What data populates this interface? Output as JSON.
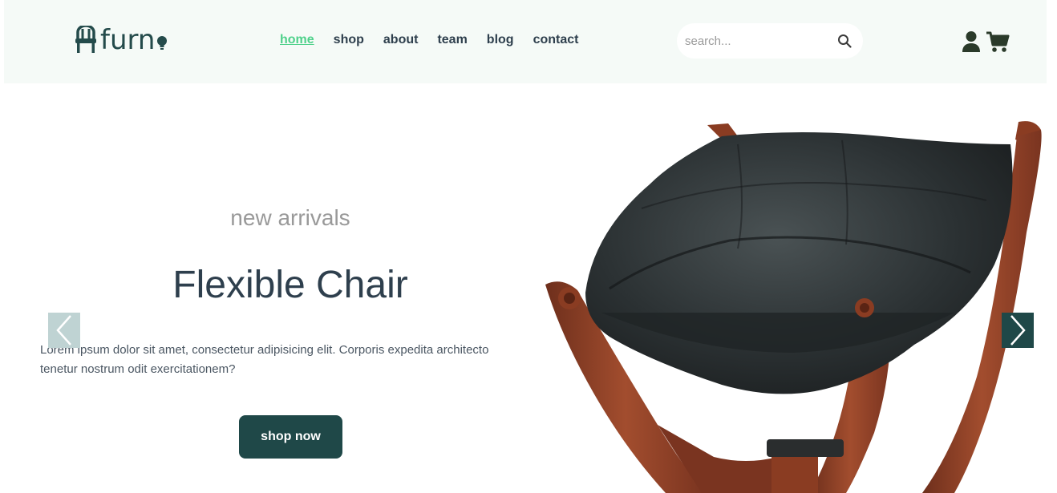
{
  "brand": {
    "name": "furn"
  },
  "nav": {
    "items": [
      {
        "label": "home",
        "active": true
      },
      {
        "label": "shop",
        "active": false
      },
      {
        "label": "about",
        "active": false
      },
      {
        "label": "team",
        "active": false
      },
      {
        "label": "blog",
        "active": false
      },
      {
        "label": "contact",
        "active": false
      }
    ]
  },
  "search": {
    "placeholder": "search...",
    "value": ""
  },
  "header_icons": [
    "user-icon",
    "cart-icon"
  ],
  "hero": {
    "subtitle": "new arrivals",
    "title": "Flexible Chair",
    "description": "Lorem ipsum dolor sit amet, consectetur adipisicing elit. Corporis expedita architecto tenetur nostrum odit exercitationem?",
    "button_label": "shop now",
    "image": "chair-image"
  },
  "colors": {
    "accent": "#4fd18b",
    "brand_dark": "#1f4848",
    "text_dark": "#2e3f4d",
    "header_bg": "#f5faf7"
  }
}
